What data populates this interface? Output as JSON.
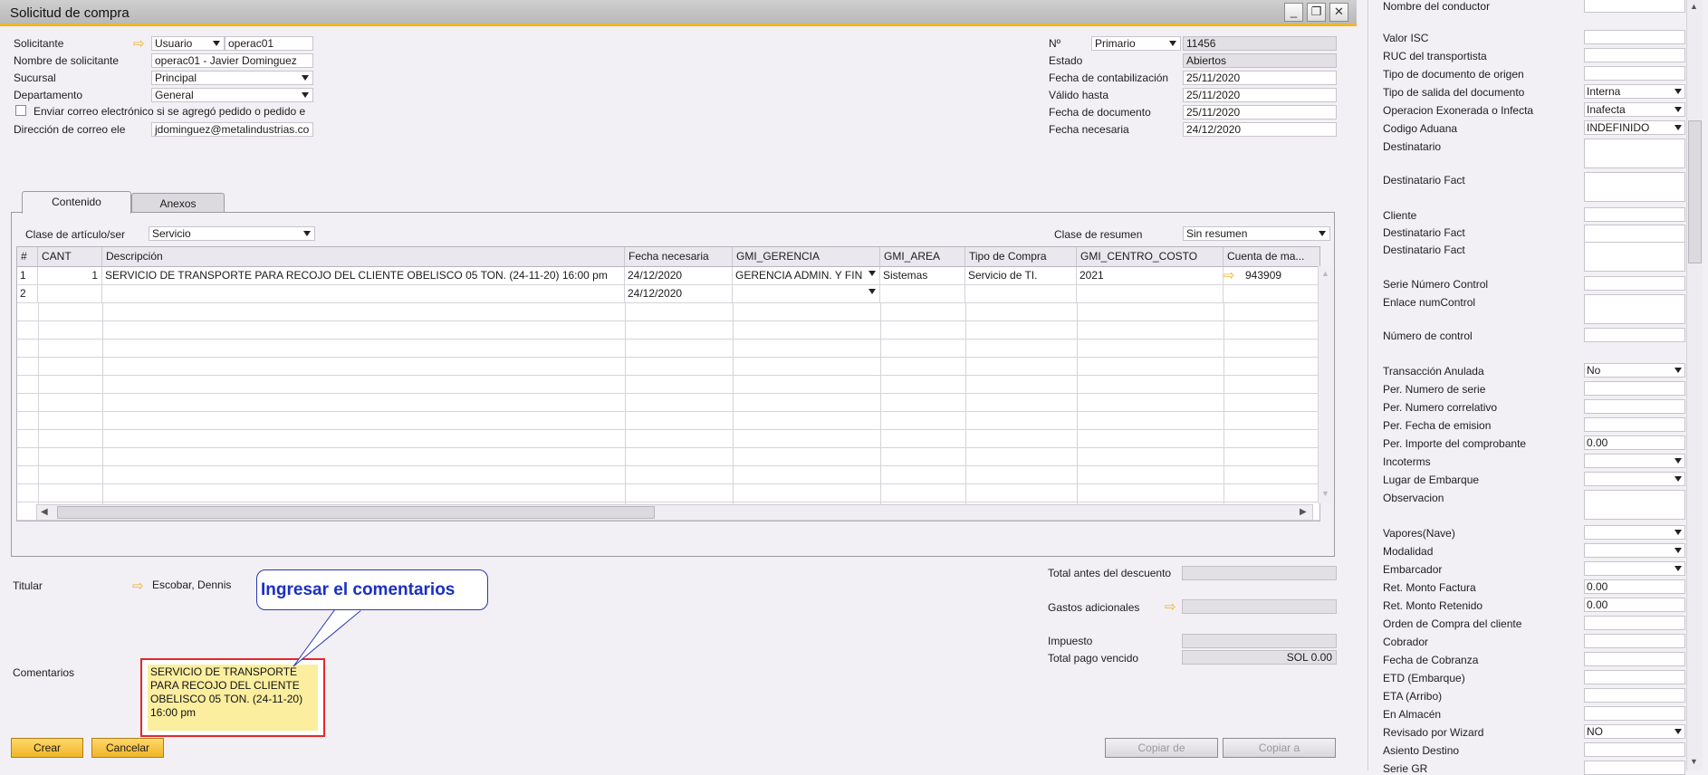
{
  "window": {
    "title": "Solicitud de compra",
    "controls": {
      "minimize": "_",
      "restore": "❐",
      "close": "✕"
    }
  },
  "header": {
    "solicitante_label": "Solicitante",
    "solicitante_type": "Usuario",
    "solicitante_value": "operac01",
    "nombre_label": "Nombre de solicitante",
    "nombre_value": "operac01 - Javier Dominguez",
    "sucursal_label": "Sucursal",
    "sucursal_value": "Principal",
    "departamento_label": "Departamento",
    "departamento_value": "General",
    "email_check_label": "Enviar correo electrónico si se agregó pedido o pedido e",
    "email_label": "Dirección de correo ele",
    "email_value": "jdominguez@metalindustrias.co",
    "no_label": "Nº",
    "no_series": "Primario",
    "no_value": "11456",
    "estado_label": "Estado",
    "estado_value": "Abiertos",
    "fecha_cont_label": "Fecha de contabilización",
    "fecha_cont_value": "25/11/2020",
    "valido_label": "Válido hasta",
    "valido_value": "25/11/2020",
    "fecha_doc_label": "Fecha de documento",
    "fecha_doc_value": "25/11/2020",
    "fecha_nec_label": "Fecha necesaria",
    "fecha_nec_value": "24/12/2020"
  },
  "tabs": {
    "contenido": "Contenido",
    "anexos": "Anexos"
  },
  "content": {
    "clase_articulo_label": "Clase de artículo/ser",
    "clase_articulo_value": "Servicio",
    "clase_resumen_label": "Clase de resumen",
    "clase_resumen_value": "Sin resumen"
  },
  "grid": {
    "columns": [
      "#",
      "CANT",
      "Descripción",
      "Fecha necesaria",
      "GMI_GERENCIA",
      "GMI_AREA",
      "Tipo de Compra",
      "GMI_CENTRO_COSTO",
      "Cuenta de ma..."
    ],
    "rows": [
      [
        "1",
        "1",
        "SERVICIO DE TRANSPORTE PARA RECOJO DEL CLIENTE OBELISCO 05 TON. (24-11-20) 16:00 pm",
        "24/12/2020",
        "GERENCIA ADMIN. Y FIN",
        "Sistemas",
        "Servicio de TI.",
        "2021",
        "943909"
      ],
      [
        "2",
        "",
        "",
        "24/12/2020",
        "",
        "",
        "",
        "",
        ""
      ]
    ]
  },
  "footer": {
    "titular_label": "Titular",
    "titular_value": "Escobar, Dennis",
    "comentarios_label": "Comentarios",
    "comentarios_value": "SERVICIO DE TRANSPORTE PARA RECOJO DEL CLIENTE OBELISCO 05 TON. (24-11-20) 16:00 pm",
    "callout_text": "Ingresar el comentarios",
    "total_antes_label": "Total antes del descuento",
    "total_antes_value": "",
    "gastos_label": "Gastos adicionales",
    "gastos_value": "",
    "impuesto_label": "Impuesto",
    "impuesto_value": "",
    "total_pago_label": "Total pago vencido",
    "total_pago_value": "SOL 0.00",
    "crear_button": "Crear",
    "cancelar_button": "Cancelar",
    "copiar_de_button": "Copiar de",
    "copiar_a_button": "Copiar a"
  },
  "user_fields": [
    {
      "label": "Nombre del conductor",
      "value": "",
      "kind": "text"
    },
    {
      "label": "Valor ISC",
      "value": "",
      "kind": "text"
    },
    {
      "label": "RUC del transportista",
      "value": "",
      "kind": "text"
    },
    {
      "label": "Tipo de documento de origen",
      "value": "",
      "kind": "text"
    },
    {
      "label": "Tipo de salida del documento",
      "value": "Interna",
      "kind": "select"
    },
    {
      "label": "Operacion Exonerada o Infecta",
      "value": "Inafecta",
      "kind": "select"
    },
    {
      "label": "Codigo Aduana",
      "value": "INDEFINIDO",
      "kind": "select"
    },
    {
      "label": "Destinatario",
      "value": "",
      "kind": "tall"
    },
    {
      "label": "Destinatario Fact",
      "value": "",
      "kind": "tall"
    },
    {
      "label": "Cliente",
      "value": "",
      "kind": "text"
    },
    {
      "label": "Destinatario Fact",
      "value": "",
      "kind": "tall"
    },
    {
      "label": "Destinatario Fact",
      "value": "",
      "kind": "tall"
    },
    {
      "label": "Serie Número Control",
      "value": "",
      "kind": "text"
    },
    {
      "label": "Enlace numControl",
      "value": "",
      "kind": "tall"
    },
    {
      "label": "Número de control",
      "value": "",
      "kind": "text"
    },
    {
      "label": "Transacción Anulada",
      "value": "No",
      "kind": "select"
    },
    {
      "label": "Per. Numero de serie",
      "value": "",
      "kind": "text"
    },
    {
      "label": "Per. Numero correlativo",
      "value": "",
      "kind": "text"
    },
    {
      "label": "Per. Fecha de emision",
      "value": "",
      "kind": "text"
    },
    {
      "label": "Per. Importe del comprobante",
      "value": "0.00",
      "kind": "text"
    },
    {
      "label": "Incoterms",
      "value": "",
      "kind": "select"
    },
    {
      "label": "Lugar de Embarque",
      "value": "",
      "kind": "select"
    },
    {
      "label": "Observacion",
      "value": "",
      "kind": "tall"
    },
    {
      "label": "Vapores(Nave)",
      "value": "",
      "kind": "select"
    },
    {
      "label": "Modalidad",
      "value": "",
      "kind": "select"
    },
    {
      "label": "Embarcador",
      "value": "",
      "kind": "select"
    },
    {
      "label": "Ret. Monto Factura",
      "value": "0.00",
      "kind": "text"
    },
    {
      "label": "Ret. Monto Retenido",
      "value": "0.00",
      "kind": "text"
    },
    {
      "label": "Orden de Compra del cliente",
      "value": "",
      "kind": "text"
    },
    {
      "label": "Cobrador",
      "value": "",
      "kind": "text"
    },
    {
      "label": "Fecha de Cobranza",
      "value": "",
      "kind": "text"
    },
    {
      "label": "ETD (Embarque)",
      "value": "",
      "kind": "text"
    },
    {
      "label": "ETA (Arribo)",
      "value": "",
      "kind": "text"
    },
    {
      "label": "En Almacén",
      "value": "",
      "kind": "text"
    },
    {
      "label": "Revisado por Wizard",
      "value": "NO",
      "kind": "select"
    },
    {
      "label": "Asiento Destino",
      "value": "",
      "kind": "text"
    },
    {
      "label": "Serie GR",
      "value": "",
      "kind": "text"
    }
  ]
}
